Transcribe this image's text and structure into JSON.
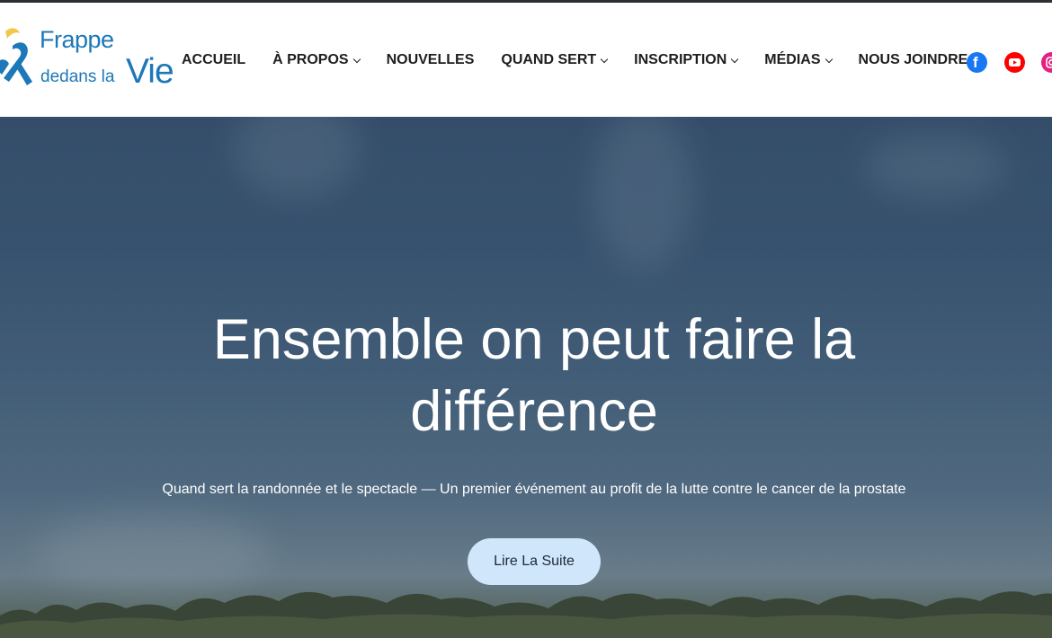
{
  "brand": {
    "logo_line1": "Frappe",
    "logo_line2": "dedans la",
    "logo_vie": "Vie"
  },
  "nav": {
    "items": [
      {
        "label": "ACCUEIL",
        "dropdown": false
      },
      {
        "label": "À PROPOS",
        "dropdown": true
      },
      {
        "label": "NOUVELLES",
        "dropdown": false
      },
      {
        "label": "QUAND SERT",
        "dropdown": true
      },
      {
        "label": "INSCRIPTION",
        "dropdown": true
      },
      {
        "label": "MÉDIAS",
        "dropdown": true
      },
      {
        "label": "NOUS JOINDRE",
        "dropdown": true
      }
    ]
  },
  "social": {
    "icons": [
      "facebook-icon",
      "youtube-icon",
      "instagram-icon"
    ],
    "colors": [
      "#1877f2",
      "#ff0000",
      "#e4207f"
    ]
  },
  "hero": {
    "title_line1": "Ensemble on peut faire la",
    "title_line2": "différence",
    "subtitle": "Quand sert la randonnée et le spectacle — Un premier événement au profit de la lutte contre le cancer de la prostate",
    "cta_label": "Lire La Suite"
  },
  "colors": {
    "brand_blue": "#1c78b8",
    "cta_bg": "#cfe6fb",
    "topbar": "#2b2f33"
  }
}
